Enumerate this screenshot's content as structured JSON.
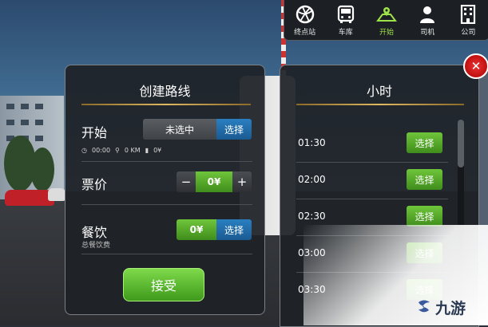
{
  "toolbar": {
    "items": [
      {
        "label": "终点站",
        "icon": "globe-icon"
      },
      {
        "label": "车库",
        "icon": "bus-icon"
      },
      {
        "label": "开始",
        "icon": "map-icon",
        "active": true
      },
      {
        "label": "司机",
        "icon": "driver-icon"
      },
      {
        "label": "公司",
        "icon": "building-icon"
      }
    ]
  },
  "route_panel": {
    "title": "创建路线",
    "start": {
      "label": "开始",
      "value": "未选中",
      "button": "选择"
    },
    "stats": {
      "time": "00:00",
      "distance": "0 KM",
      "fuel": "0¥"
    },
    "ticket": {
      "label": "票价",
      "minus": "−",
      "value": "0¥",
      "plus": "+"
    },
    "meal": {
      "label": "餐饮",
      "sublabel": "总餐饮费",
      "value": "0¥",
      "button": "选择"
    },
    "accept_button": "接受"
  },
  "time_panel": {
    "title": "小时",
    "rows": [
      {
        "time": "01:30",
        "button": "选择"
      },
      {
        "time": "02:00",
        "button": "选择"
      },
      {
        "time": "02:30",
        "button": "选择"
      },
      {
        "time": "03:00",
        "button": "选择"
      },
      {
        "time": "03:30",
        "button": "选择"
      }
    ]
  },
  "close_label": "✕",
  "watermark": {
    "text": "九游"
  },
  "colors": {
    "accent_green": "#6fc53a",
    "accent_blue": "#2a7fc0",
    "gold": "#e0b860",
    "close_red": "#e33"
  }
}
